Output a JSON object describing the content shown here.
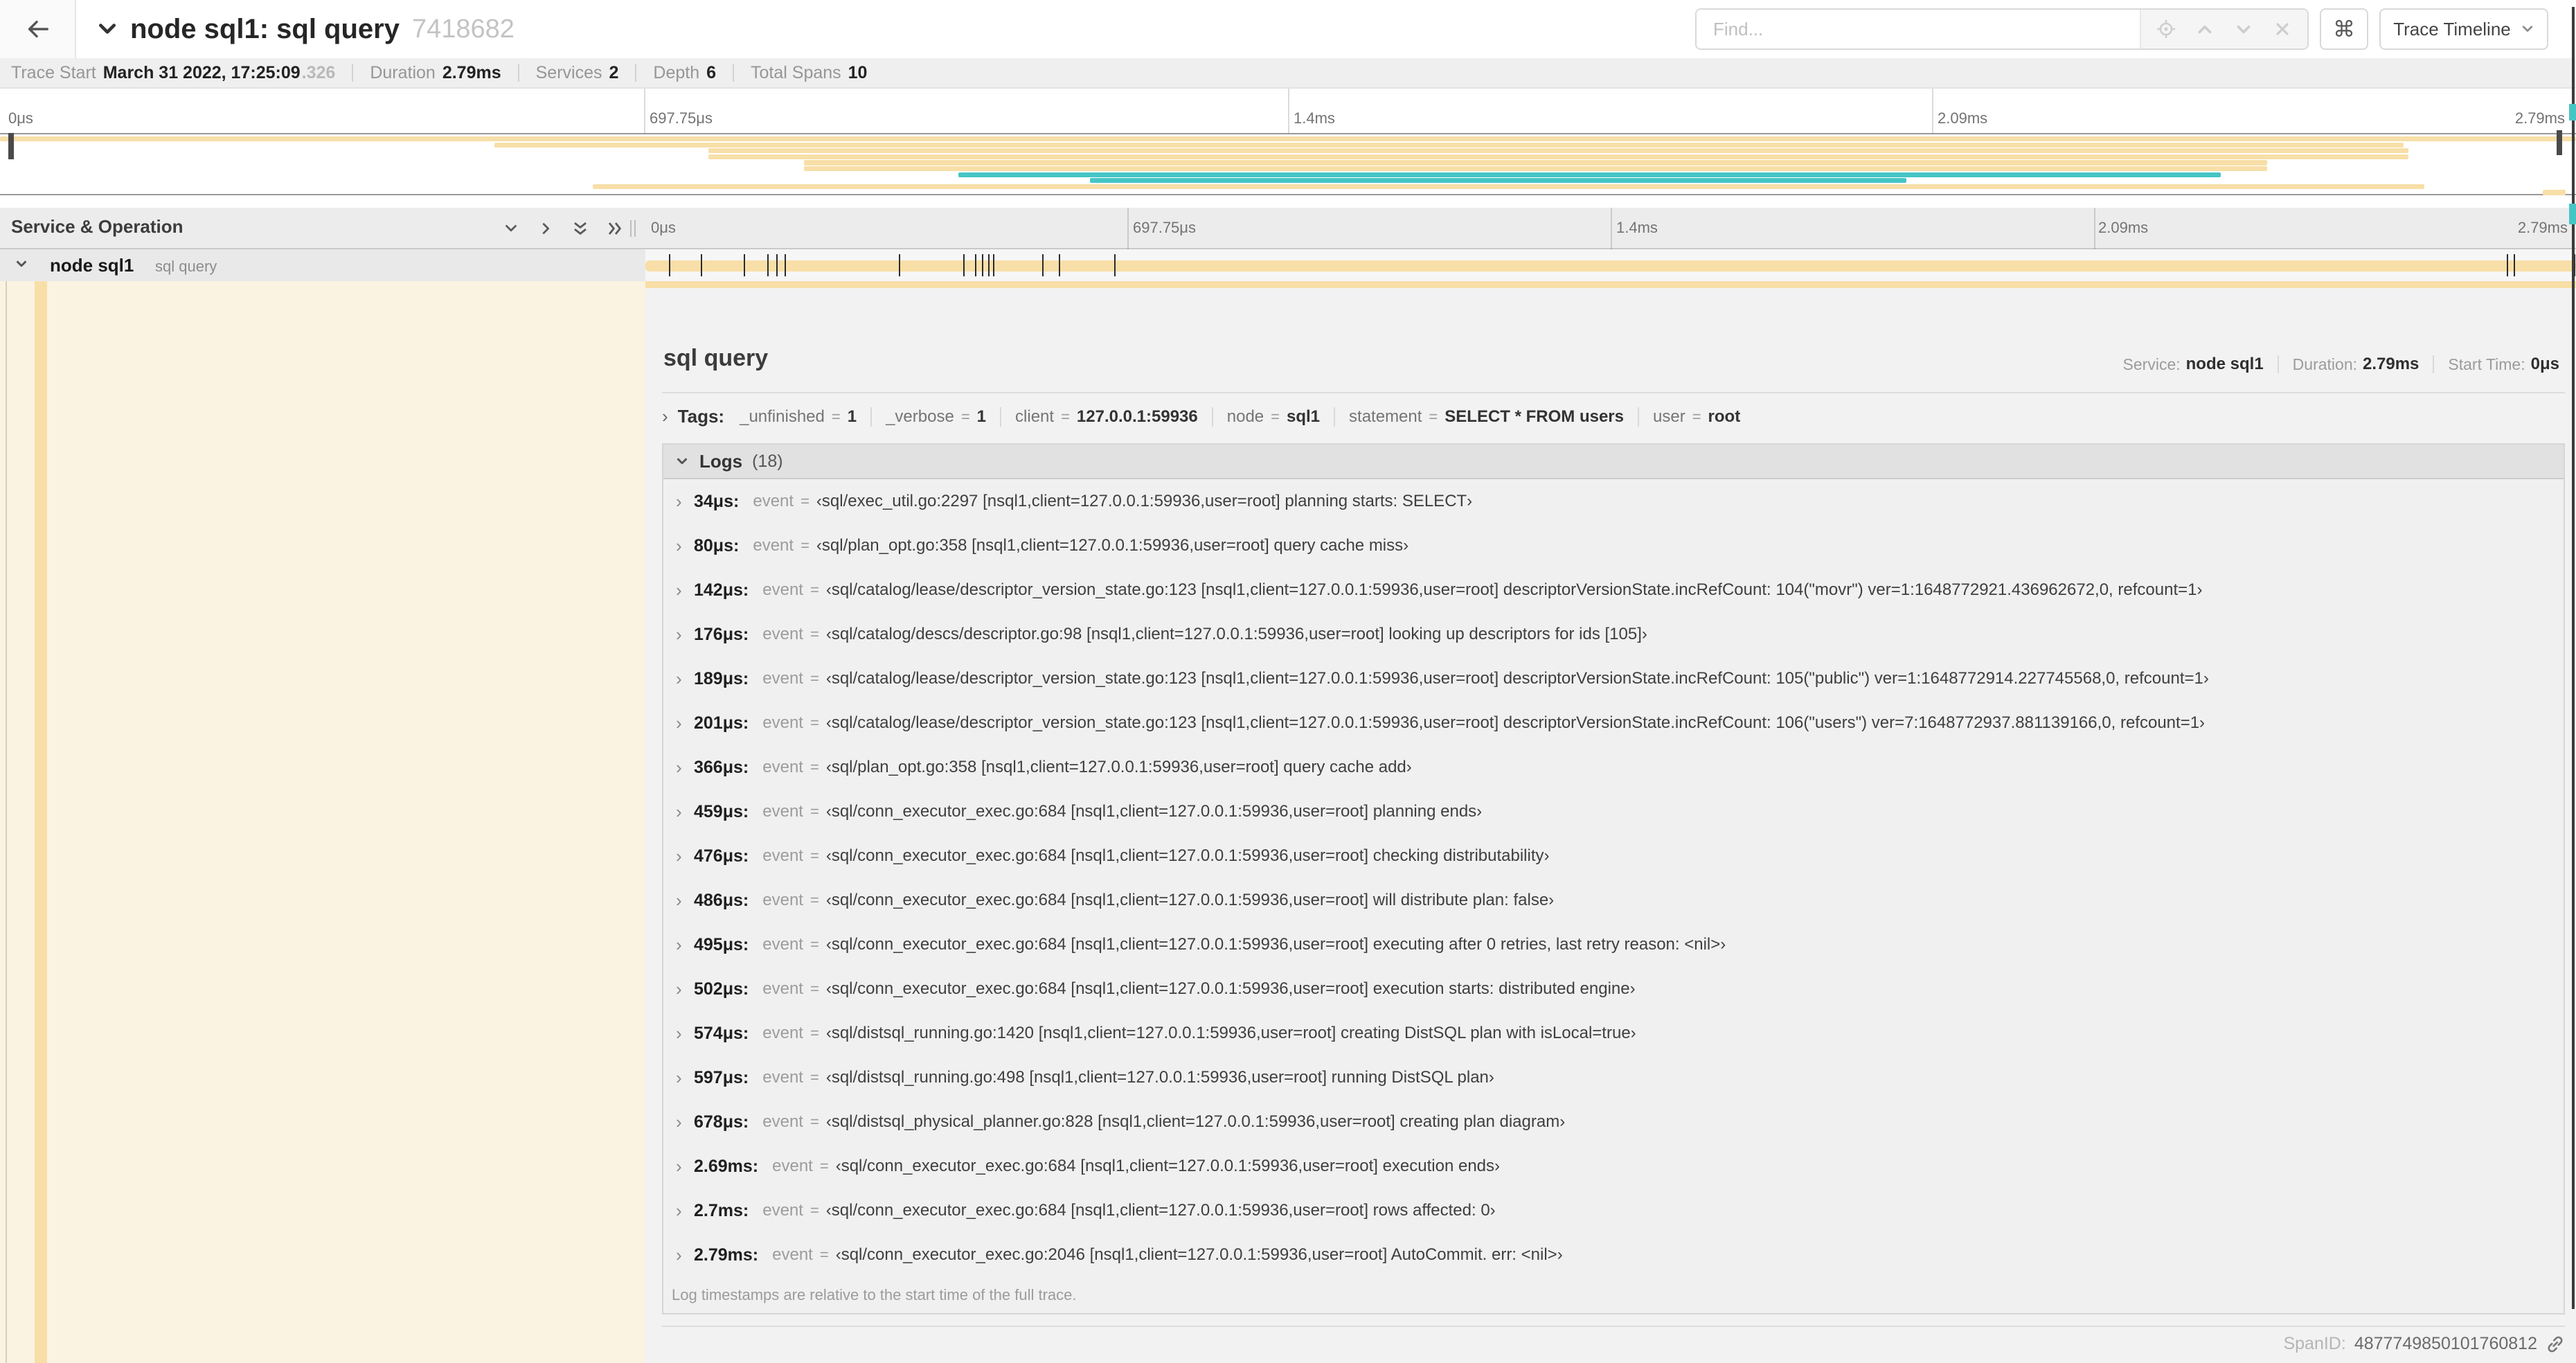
{
  "colors": {
    "tan": "#F8DFA8",
    "teal": "#46C5C5",
    "cream_bg": "#fbf3e1"
  },
  "header": {
    "title": "node sql1: sql query",
    "trace_id": "7418682",
    "find_placeholder": "Find...",
    "shortcut_icon": "⌘",
    "view_selector": "Trace Timeline"
  },
  "trace_stats": [
    {
      "label": "Trace Start",
      "value": "March 31 2022, 17:25:09",
      "suffix": ".326"
    },
    {
      "label": "Duration",
      "value": "2.79ms"
    },
    {
      "label": "Services",
      "value": "2"
    },
    {
      "label": "Depth",
      "value": "6"
    },
    {
      "label": "Total Spans",
      "value": "10"
    }
  ],
  "minimap": {
    "ticks": [
      "0μs",
      "697.75μs",
      "1.4ms",
      "2.09ms",
      "2.79ms"
    ],
    "spans": [
      {
        "start": 0,
        "end": 100,
        "color": "tan"
      },
      {
        "start": 19.2,
        "end": 93.3,
        "color": "tan"
      },
      {
        "start": 27.5,
        "end": 93.5,
        "color": "tan"
      },
      {
        "start": 27.5,
        "end": 93.5,
        "color": "tan"
      },
      {
        "start": 31.2,
        "end": 88,
        "color": "tan"
      },
      {
        "start": 31.2,
        "end": 88,
        "color": "tan"
      },
      {
        "start": 37.2,
        "end": 86.2,
        "color": "teal"
      },
      {
        "start": 42.3,
        "end": 74,
        "color": "teal"
      },
      {
        "start": 23,
        "end": 94.1,
        "color": "tan"
      },
      {
        "start": 98.7,
        "end": 99.6,
        "color": "tan"
      }
    ]
  },
  "timeline": {
    "left_header": "Service & Operation",
    "ticks": [
      "0μs",
      "697.75μs",
      "1.4ms",
      "2.09ms",
      "2.79ms"
    ]
  },
  "span_row": {
    "service": "node sql1",
    "operation": "sql query",
    "log_tick_positions": [
      1.22,
      2.87,
      5.09,
      6.31,
      6.77,
      7.2,
      13.12,
      16.45,
      17.06,
      17.42,
      17.74,
      18.0,
      20.57,
      21.4,
      24.3,
      96.42,
      96.77,
      99.9
    ]
  },
  "detail": {
    "title": "sql query",
    "meta": [
      {
        "label": "Service:",
        "value": "node sql1"
      },
      {
        "label": "Duration:",
        "value": "2.79ms"
      },
      {
        "label": "Start Time:",
        "value": "0μs"
      }
    ],
    "tags_label": "Tags:",
    "tags": [
      {
        "key": "_unfinished",
        "value": "1"
      },
      {
        "key": "_verbose",
        "value": "1"
      },
      {
        "key": "client",
        "value": "127.0.0.1:59936"
      },
      {
        "key": "node",
        "value": "sql1"
      },
      {
        "key": "statement",
        "value": "SELECT * FROM users"
      },
      {
        "key": "user",
        "value": "root"
      }
    ],
    "logs_label": "Logs",
    "logs_count": "(18)",
    "logs": [
      {
        "time": "34μs:",
        "field": "event",
        "value": "‹sql/exec_util.go:2297 [nsql1,client=127.0.0.1:59936,user=root] planning starts: SELECT›"
      },
      {
        "time": "80μs:",
        "field": "event",
        "value": "‹sql/plan_opt.go:358 [nsql1,client=127.0.0.1:59936,user=root] query cache miss›"
      },
      {
        "time": "142μs:",
        "field": "event",
        "value": "‹sql/catalog/lease/descriptor_version_state.go:123 [nsql1,client=127.0.0.1:59936,user=root] descriptorVersionState.incRefCount: 104(\"movr\") ver=1:1648772921.436962672,0, refcount=1›"
      },
      {
        "time": "176μs:",
        "field": "event",
        "value": "‹sql/catalog/descs/descriptor.go:98 [nsql1,client=127.0.0.1:59936,user=root] looking up descriptors for ids [105]›"
      },
      {
        "time": "189μs:",
        "field": "event",
        "value": "‹sql/catalog/lease/descriptor_version_state.go:123 [nsql1,client=127.0.0.1:59936,user=root] descriptorVersionState.incRefCount: 105(\"public\") ver=1:1648772914.227745568,0, refcount=1›"
      },
      {
        "time": "201μs:",
        "field": "event",
        "value": "‹sql/catalog/lease/descriptor_version_state.go:123 [nsql1,client=127.0.0.1:59936,user=root] descriptorVersionState.incRefCount: 106(\"users\") ver=7:1648772937.881139166,0, refcount=1›"
      },
      {
        "time": "366μs:",
        "field": "event",
        "value": "‹sql/plan_opt.go:358 [nsql1,client=127.0.0.1:59936,user=root] query cache add›"
      },
      {
        "time": "459μs:",
        "field": "event",
        "value": "‹sql/conn_executor_exec.go:684 [nsql1,client=127.0.0.1:59936,user=root] planning ends›"
      },
      {
        "time": "476μs:",
        "field": "event",
        "value": "‹sql/conn_executor_exec.go:684 [nsql1,client=127.0.0.1:59936,user=root] checking distributability›"
      },
      {
        "time": "486μs:",
        "field": "event",
        "value": "‹sql/conn_executor_exec.go:684 [nsql1,client=127.0.0.1:59936,user=root] will distribute plan: false›"
      },
      {
        "time": "495μs:",
        "field": "event",
        "value": "‹sql/conn_executor_exec.go:684 [nsql1,client=127.0.0.1:59936,user=root] executing after 0 retries, last retry reason: <nil>›"
      },
      {
        "time": "502μs:",
        "field": "event",
        "value": "‹sql/conn_executor_exec.go:684 [nsql1,client=127.0.0.1:59936,user=root] execution starts: distributed engine›"
      },
      {
        "time": "574μs:",
        "field": "event",
        "value": "‹sql/distsql_running.go:1420 [nsql1,client=127.0.0.1:59936,user=root] creating DistSQL plan with isLocal=true›"
      },
      {
        "time": "597μs:",
        "field": "event",
        "value": "‹sql/distsql_running.go:498 [nsql1,client=127.0.0.1:59936,user=root] running DistSQL plan›"
      },
      {
        "time": "678μs:",
        "field": "event",
        "value": "‹sql/distsql_physical_planner.go:828 [nsql1,client=127.0.0.1:59936,user=root] creating plan diagram›"
      },
      {
        "time": "2.69ms:",
        "field": "event",
        "value": "‹sql/conn_executor_exec.go:684 [nsql1,client=127.0.0.1:59936,user=root] execution ends›"
      },
      {
        "time": "2.7ms:",
        "field": "event",
        "value": "‹sql/conn_executor_exec.go:684 [nsql1,client=127.0.0.1:59936,user=root] rows affected: 0›"
      },
      {
        "time": "2.79ms:",
        "field": "event",
        "value": "‹sql/conn_executor_exec.go:2046 [nsql1,client=127.0.0.1:59936,user=root] AutoCommit. err: <nil>›"
      }
    ],
    "logs_note": "Log timestamps are relative to the start time of the full trace.",
    "span_id_label": "SpanID:",
    "span_id": "4877749850101760812"
  }
}
